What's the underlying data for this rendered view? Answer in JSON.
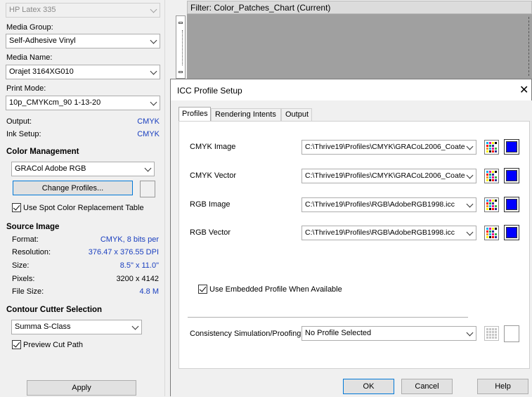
{
  "left": {
    "printer": "HP Latex 335",
    "media_group_label": "Media Group:",
    "media_group": "Self-Adhesive Vinyl",
    "media_name_label": "Media Name:",
    "media_name": "Orajet 3164XG010",
    "print_mode_label": "Print Mode:",
    "print_mode": "10p_CMYKcm_90 1-13-20",
    "output_label": "Output:",
    "output": "CMYK",
    "ink_setup_label": "Ink Setup:",
    "ink_setup": "CMYK",
    "color_mgmt_title": "Color Management",
    "color_profile": "GRACol Adobe RGB",
    "change_profiles": "Change Profiles...",
    "spot_color_label": "Use Spot Color Replacement Table",
    "source_image_title": "Source Image",
    "format_label": "Format:",
    "format": "CMYK, 8 bits per",
    "resolution_label": "Resolution:",
    "resolution": "376.47 x 376.55 DPI",
    "size_label": "Size:",
    "size": "8.5\" x 11.0\"",
    "pixels_label": "Pixels:",
    "pixels": "3200 x 4142",
    "file_size_label": "File Size:",
    "file_size": "4.8 M",
    "contour_title": "Contour Cutter Selection",
    "cutter": "Summa S-Class",
    "preview_cut_label": "Preview Cut Path",
    "apply": "Apply"
  },
  "filter": {
    "title": "Filter: Color_Patches_Chart (Current)"
  },
  "dialog": {
    "title": "ICC Profile Setup",
    "tabs": [
      "Profiles",
      "Rendering Intents",
      "Output"
    ],
    "profiles": [
      {
        "label": "CMYK Image",
        "value": "C:\\Thrive19\\Profiles\\CMYK\\GRACoL2006_Coate"
      },
      {
        "label": "CMYK Vector",
        "value": "C:\\Thrive19\\Profiles\\CMYK\\GRACoL2006_Coate"
      },
      {
        "label": "RGB Image",
        "value": "C:\\Thrive19\\Profiles\\RGB\\AdobeRGB1998.icc"
      },
      {
        "label": "RGB Vector",
        "value": "C:\\Thrive19\\Profiles\\RGB\\AdobeRGB1998.icc"
      }
    ],
    "embedded_label": "Use Embedded Profile When Available",
    "consistency_label": "Consistency Simulation/Proofing",
    "consistency_value": "No Profile Selected",
    "ok": "OK",
    "cancel": "Cancel",
    "help": "Help"
  },
  "colors": {
    "value_text": "#1a3fbf",
    "profile_swatch": "#0000ff",
    "preview_bg": "#a0a0a0"
  }
}
